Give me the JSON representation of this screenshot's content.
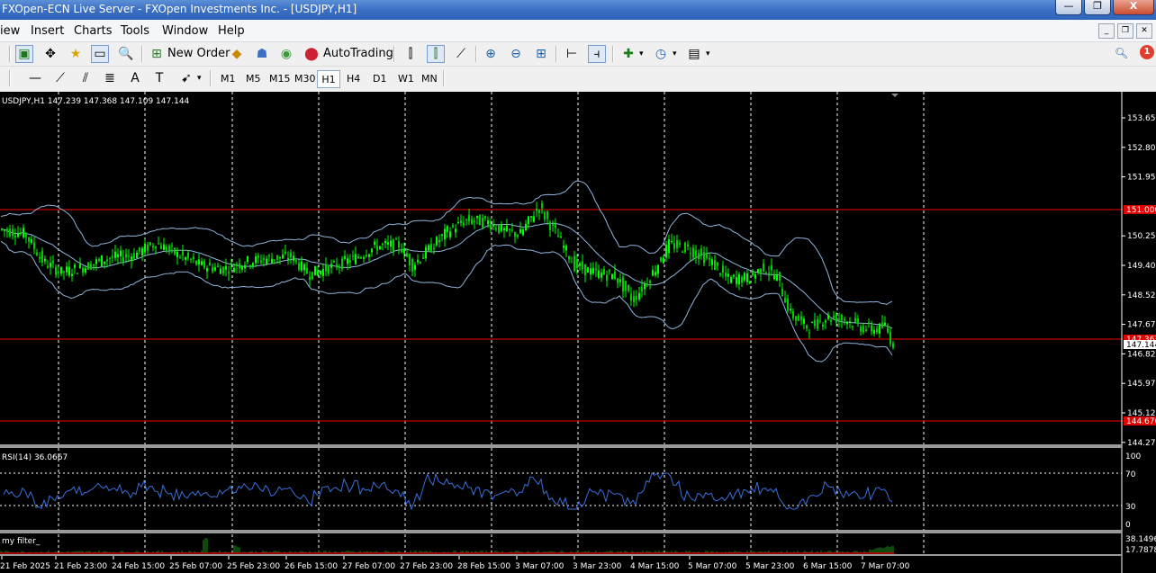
{
  "window": {
    "title": "FXOpen-ECN Live Server - FXOpen Investments Inc. - [USDJPY,H1]",
    "minimize": "—",
    "restore": "❐",
    "close": "X"
  },
  "menu": {
    "items": [
      "iew",
      "Insert",
      "Charts",
      "Tools",
      "Window",
      "Help"
    ]
  },
  "toolbar": {
    "new_order": "New Order",
    "auto_trading": "AutoTrading",
    "timeframes": [
      "M1",
      "M5",
      "M15",
      "M30",
      "H1",
      "H4",
      "D1",
      "W1",
      "MN"
    ],
    "active_timeframe": "H1",
    "notification_count": "1"
  },
  "chart": {
    "header": "USDJPY,H1  147.239 147.368 147.109 147.144",
    "price_levels": [
      "153.650",
      "152.800",
      "151.950",
      "150.250",
      "149.400",
      "148.525",
      "147.675",
      "146.825",
      "145.975",
      "145.125",
      "144.275"
    ],
    "level_tags": [
      "151.000",
      "147.367",
      "147.144",
      "144.670"
    ],
    "date_labels": [
      "21 Feb 2025",
      "21 Feb 23:00",
      "24 Feb 15:00",
      "25 Feb 07:00",
      "25 Feb 23:00",
      "26 Feb 15:00",
      "27 Feb 07:00",
      "27 Feb 23:00",
      "28 Feb 15:00",
      "3 Mar 07:00",
      "3 Mar 23:00",
      "4 Mar 15:00",
      "5 Mar 07:00",
      "5 Mar 23:00",
      "6 Mar 15:00",
      "7 Mar 07:00"
    ],
    "colors": {
      "candles": "#00ff00",
      "bands": "#8fb4dc",
      "levels": "#c00000",
      "rsi": "#3a6fd8",
      "filter_up": "#1a8f1a",
      "filter_down": "#cc0000",
      "grid": "#ffffff"
    }
  },
  "rsi_panel": {
    "label": "RSI(14) 36.0667",
    "levels": [
      "100",
      "70",
      "30",
      "0"
    ]
  },
  "filter_panel": {
    "label": "my filter_",
    "levels": [
      "38.1496",
      "17.7878"
    ]
  }
}
